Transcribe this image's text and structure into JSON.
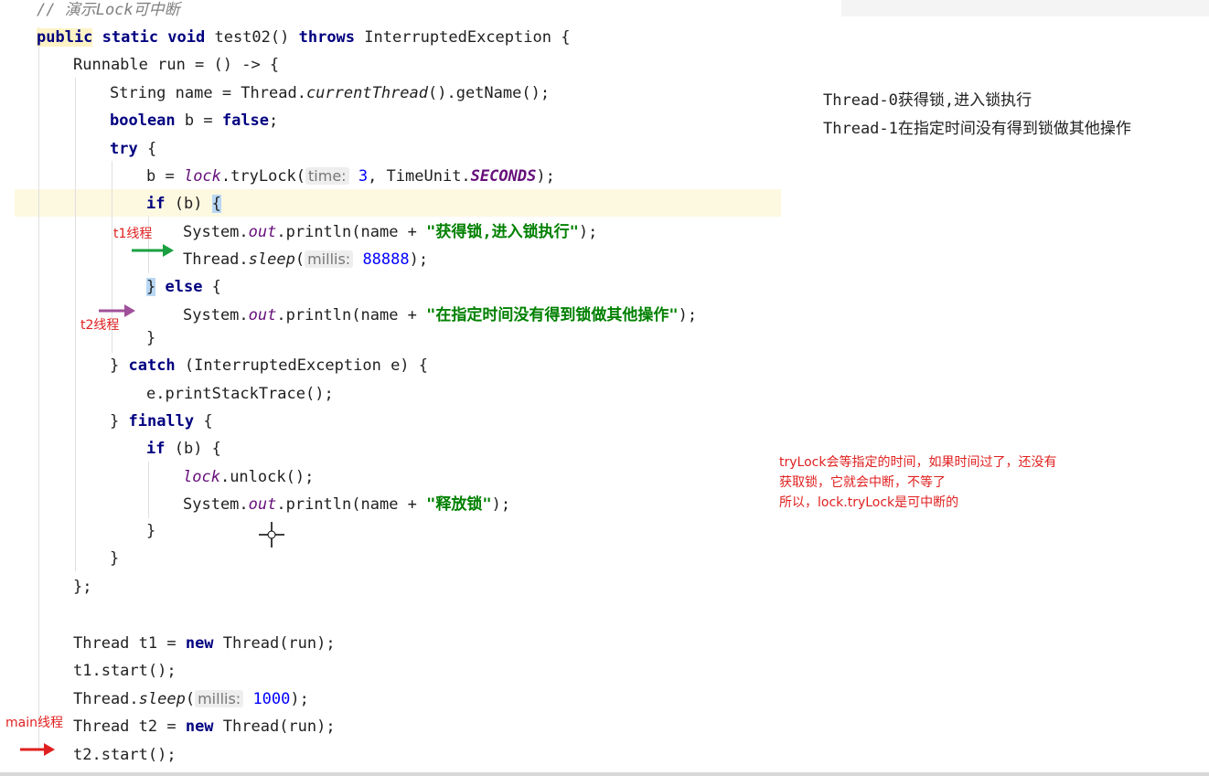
{
  "editor": {
    "comment": "// 演示Lock可中断",
    "method_sig": {
      "kw_public": "public",
      "kw_static_void": " static void ",
      "name": "test02() ",
      "kw_throws": "throws",
      "rest": " InterruptedException {"
    },
    "l_runnable": "Runnable run = () -> {",
    "l_string": {
      "pre": "String name = Thread.",
      "call": "currentThread",
      "post": "().getName();"
    },
    "l_boolean": {
      "kw": "boolean",
      "var": " b = ",
      "kw2": "false",
      "end": ";"
    },
    "l_try": {
      "kw": "try",
      "end": " {"
    },
    "l_trylock": {
      "pre": "b = ",
      "field": "lock",
      "mid": ".tryLock(",
      "hint": "time:",
      "num": "3",
      "mid2": ", TimeUnit.",
      "const": "SECONDS",
      "end": ");"
    },
    "l_if1": {
      "kw": "if",
      "var": " (b) ",
      "brace": "{"
    },
    "l_println1": {
      "pre": "System.",
      "field": "out",
      "mid": ".println(name + ",
      "str": "\"获得锁,进入锁执行\"",
      "end": ");"
    },
    "l_sleep1": {
      "pre": "Thread.",
      "call": "sleep",
      "mid": "(",
      "hint": "millis:",
      "num": "88888",
      "end": ");"
    },
    "l_else": {
      "brace": "}",
      "kw": " else",
      "end": " {"
    },
    "l_println2": {
      "pre": "System.",
      "field": "out",
      "mid": ".println(name + ",
      "str": "\"在指定时间没有得到锁做其他操作\"",
      "end": ");"
    },
    "l_close_if": "}",
    "l_catch": {
      "brace": "} ",
      "kw": "catch",
      "rest": " (InterruptedException e) {"
    },
    "l_print_trace": "e.printStackTrace();",
    "l_finally": {
      "brace": "} ",
      "kw": "finally",
      "end": " {"
    },
    "l_if2": {
      "kw": "if",
      "rest": " (b) {"
    },
    "l_unlock": {
      "field": "lock",
      "rest": ".unlock();"
    },
    "l_println3": {
      "pre": "System.",
      "field": "out",
      "mid": ".println(name + ",
      "str": "\"释放锁\"",
      "end": ");"
    },
    "l_close1": "}",
    "l_close2": "}",
    "l_close_lambda": "};",
    "l_t1": {
      "pre": "Thread t1 = ",
      "kw": "new",
      "rest": " Thread(run);"
    },
    "l_t1_start": "t1.start();",
    "l_sleep2": {
      "pre": "Thread.",
      "call": "sleep",
      "mid": "(",
      "hint": "millis:",
      "num": "1000",
      "end": ");"
    },
    "l_t2": {
      "pre": "Thread t2 = ",
      "kw": "new",
      "rest": " Thread(run);"
    },
    "l_t2_start": "t2.start();"
  },
  "annotations": {
    "t1": "t1线程",
    "t2": "t2线程",
    "main": "main线程",
    "note_lines": [
      "tryLock会等指定的时间，如果时间过了，还没有",
      "获取锁，它就会中断，不等了",
      "所以，lock.tryLock是可中断的"
    ]
  },
  "output": {
    "lines": [
      "Thread-0获得锁,进入锁执行",
      "Thread-1在指定时间没有得到锁做其他操作"
    ]
  },
  "colors": {
    "keyword": "#000080",
    "string": "#008000",
    "number": "#0000ff",
    "field": "#660e7a",
    "annotation": "#e02020",
    "arrow_t1": "#1aa040",
    "arrow_t2": "#a0509a",
    "arrow_main": "#e02020",
    "current_line": "#fdf8e0"
  }
}
